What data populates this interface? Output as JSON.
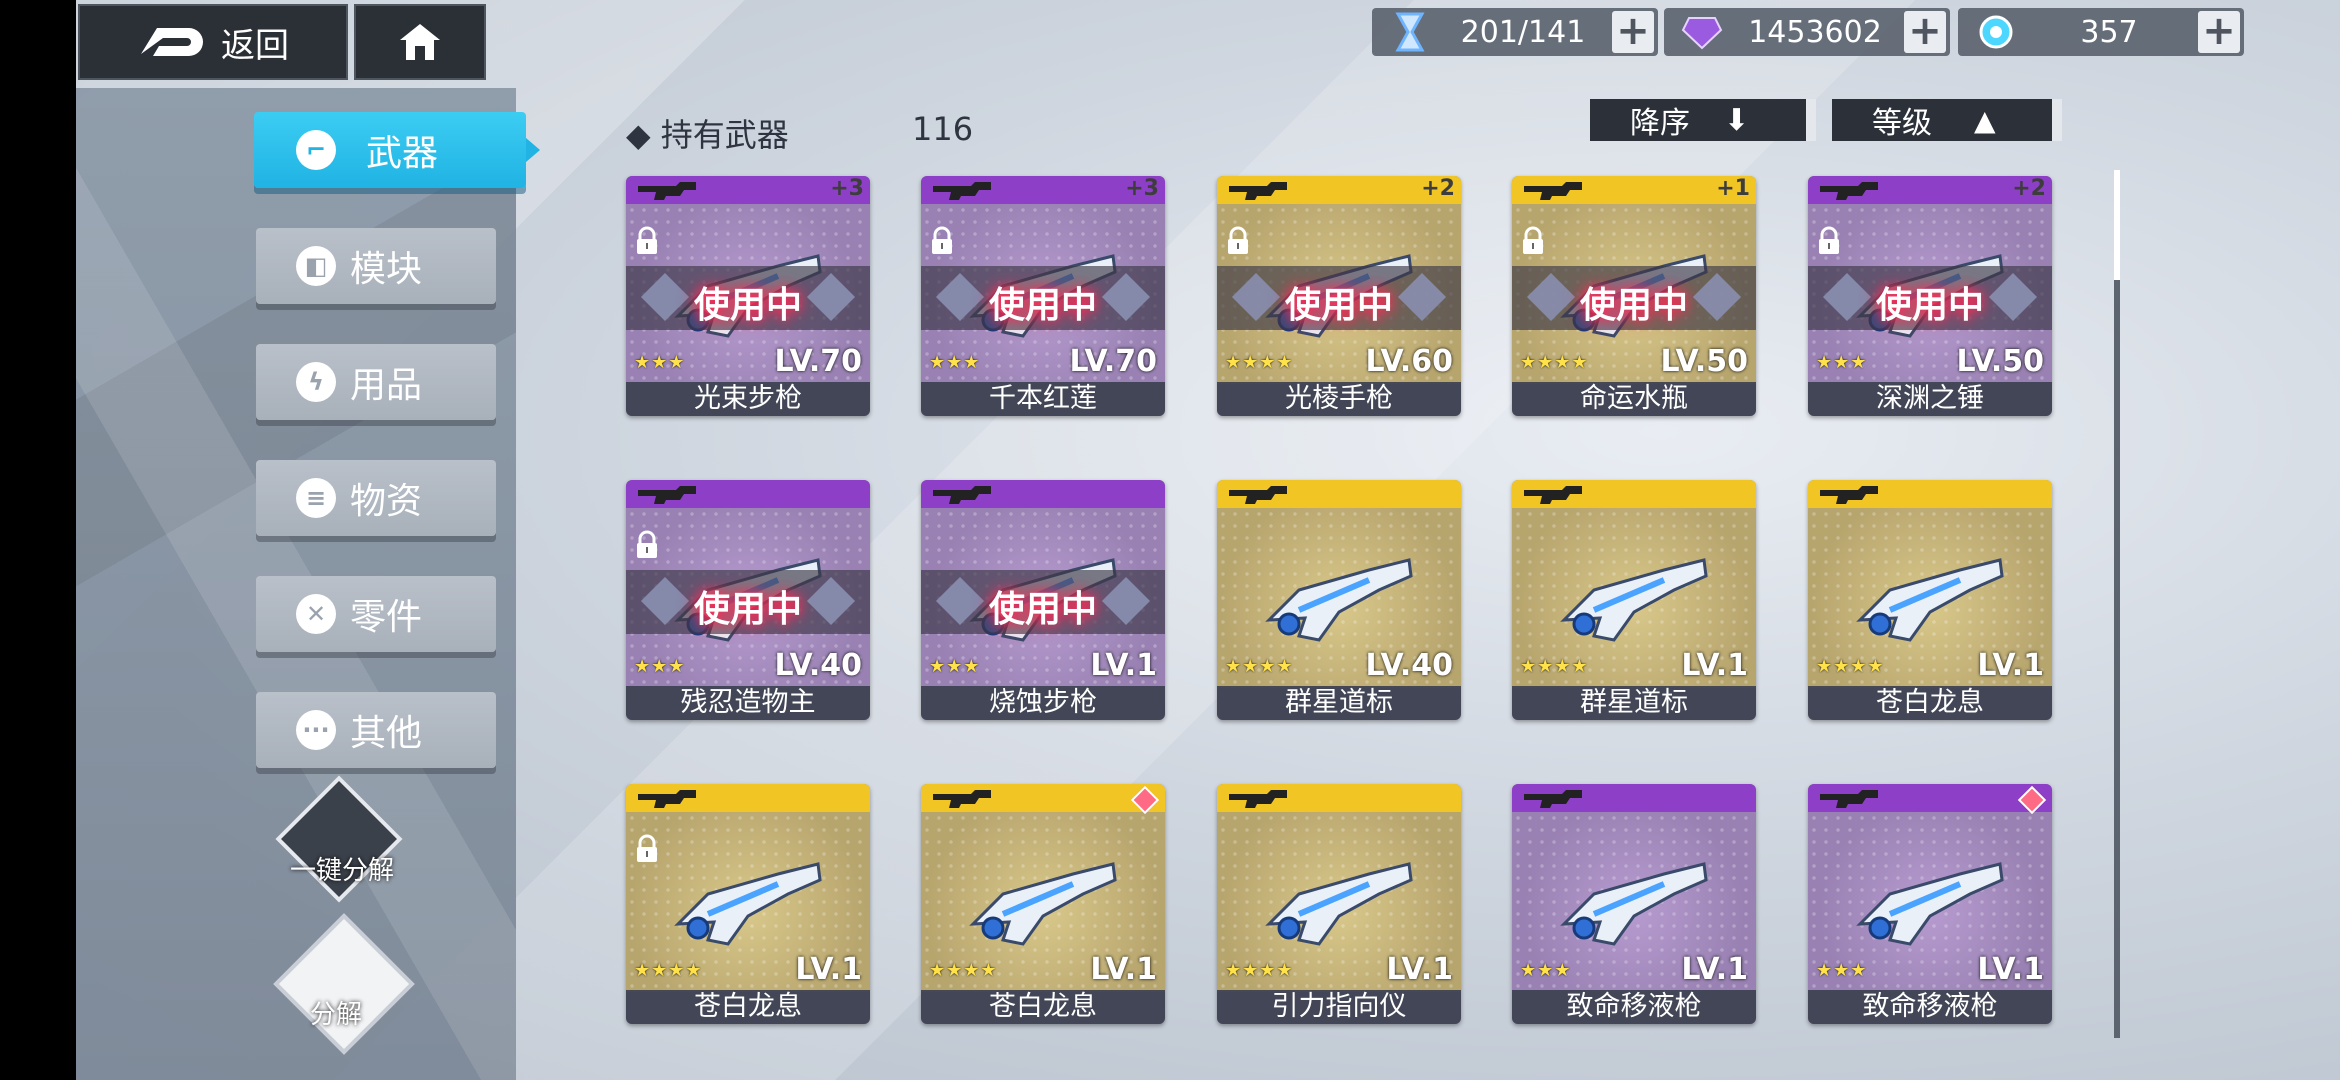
{
  "topbar": {
    "back_label": "返回",
    "resources": [
      {
        "icon": "hourglass-icon",
        "value": "201/141"
      },
      {
        "icon": "crystal-icon",
        "value": "1453602"
      },
      {
        "icon": "energy-orb-icon",
        "value": "357"
      }
    ]
  },
  "sidebar": {
    "items": [
      {
        "label": "武器",
        "icon": "weapon-icon",
        "active": true
      },
      {
        "label": "模块",
        "icon": "module-icon",
        "active": false
      },
      {
        "label": "用品",
        "icon": "lightning-icon",
        "active": false
      },
      {
        "label": "物资",
        "icon": "supplies-icon",
        "active": false
      },
      {
        "label": "零件",
        "icon": "parts-icon",
        "active": false
      },
      {
        "label": "其他",
        "icon": "more-icon",
        "active": false
      }
    ],
    "quick_dismantle_label": "一键分解",
    "dismantle_label": "分解"
  },
  "header": {
    "title": "◆ 持有武器",
    "count": "116",
    "sort_label": "降序",
    "filter_label": "等级"
  },
  "in_use_label": "使用中",
  "cards": [
    {
      "name": "光束步枪",
      "level": "LV.70",
      "stars": "★★★",
      "rarity": "purple",
      "plus": "+3",
      "in_use": true,
      "locked": true,
      "gem": false
    },
    {
      "name": "千本红莲",
      "level": "LV.70",
      "stars": "★★★",
      "rarity": "purple",
      "plus": "+3",
      "in_use": true,
      "locked": true,
      "gem": false
    },
    {
      "name": "光棱手枪",
      "level": "LV.60",
      "stars": "★★★★",
      "rarity": "gold",
      "plus": "+2",
      "in_use": true,
      "locked": true,
      "gem": false
    },
    {
      "name": "命运水瓶",
      "level": "LV.50",
      "stars": "★★★★",
      "rarity": "gold",
      "plus": "+1",
      "in_use": true,
      "locked": true,
      "gem": false
    },
    {
      "name": "深渊之锤",
      "level": "LV.50",
      "stars": "★★★",
      "rarity": "purple",
      "plus": "+2",
      "in_use": true,
      "locked": true,
      "gem": false
    },
    {
      "name": "残忍造物主",
      "level": "LV.40",
      "stars": "★★★",
      "rarity": "purple",
      "plus": "",
      "in_use": true,
      "locked": true,
      "gem": false
    },
    {
      "name": "烧蚀步枪",
      "level": "LV.1",
      "stars": "★★★",
      "rarity": "purple",
      "plus": "",
      "in_use": true,
      "locked": false,
      "gem": false
    },
    {
      "name": "群星道标",
      "level": "LV.40",
      "stars": "★★★★",
      "rarity": "gold",
      "plus": "",
      "in_use": false,
      "locked": false,
      "gem": false
    },
    {
      "name": "群星道标",
      "level": "LV.1",
      "stars": "★★★★",
      "rarity": "gold",
      "plus": "",
      "in_use": false,
      "locked": false,
      "gem": false
    },
    {
      "name": "苍白龙息",
      "level": "LV.1",
      "stars": "★★★★",
      "rarity": "gold",
      "plus": "",
      "in_use": false,
      "locked": false,
      "gem": false
    },
    {
      "name": "苍白龙息",
      "level": "LV.1",
      "stars": "★★★★",
      "rarity": "gold",
      "plus": "",
      "in_use": false,
      "locked": true,
      "gem": false
    },
    {
      "name": "苍白龙息",
      "level": "LV.1",
      "stars": "★★★★",
      "rarity": "gold",
      "plus": "",
      "in_use": false,
      "locked": false,
      "gem": true
    },
    {
      "name": "引力指向仪",
      "level": "LV.1",
      "stars": "★★★★",
      "rarity": "gold",
      "plus": "",
      "in_use": false,
      "locked": false,
      "gem": false
    },
    {
      "name": "致命移液枪",
      "level": "LV.1",
      "stars": "★★★",
      "rarity": "purple",
      "plus": "",
      "in_use": false,
      "locked": false,
      "gem": false
    },
    {
      "name": "致命移液枪",
      "level": "LV.1",
      "stars": "★★★",
      "rarity": "purple",
      "plus": "",
      "in_use": false,
      "locked": false,
      "gem": true
    }
  ]
}
